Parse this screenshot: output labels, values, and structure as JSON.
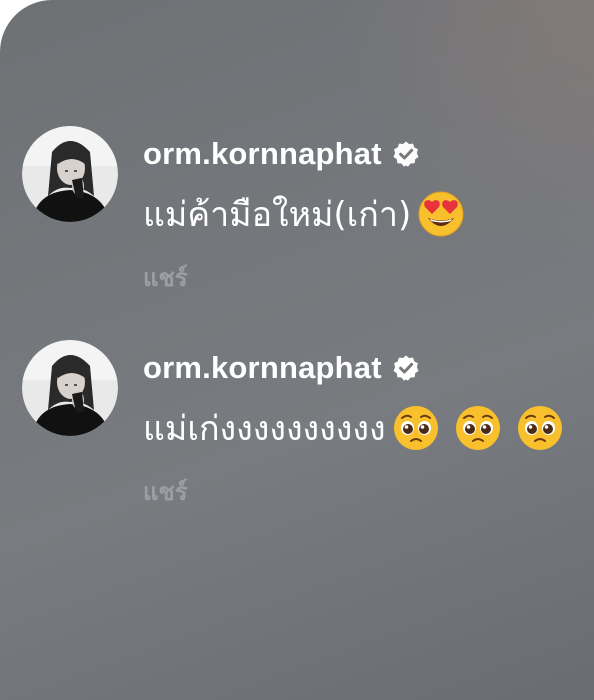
{
  "comments": [
    {
      "username": "orm.kornnaphat",
      "verified": true,
      "text": "แม่ค้ามือใหม่(เก่า)",
      "emojis": [
        "smiling-face-with-heart-eyes"
      ],
      "share_label": "แชร์"
    },
    {
      "username": "orm.kornnaphat",
      "verified": true,
      "text": "แม่เก่งงงงงงงงงง",
      "emojis": [
        "pleading-face",
        "pleading-face",
        "pleading-face"
      ],
      "share_label": "แชร์"
    }
  ],
  "colors": {
    "text": "#ffffff",
    "share": "#9b9ea3",
    "background": "#75787c",
    "verified_badge": "#ffffff",
    "emoji_yellow": "#f7c02c",
    "heart_red": "#e8323c"
  }
}
